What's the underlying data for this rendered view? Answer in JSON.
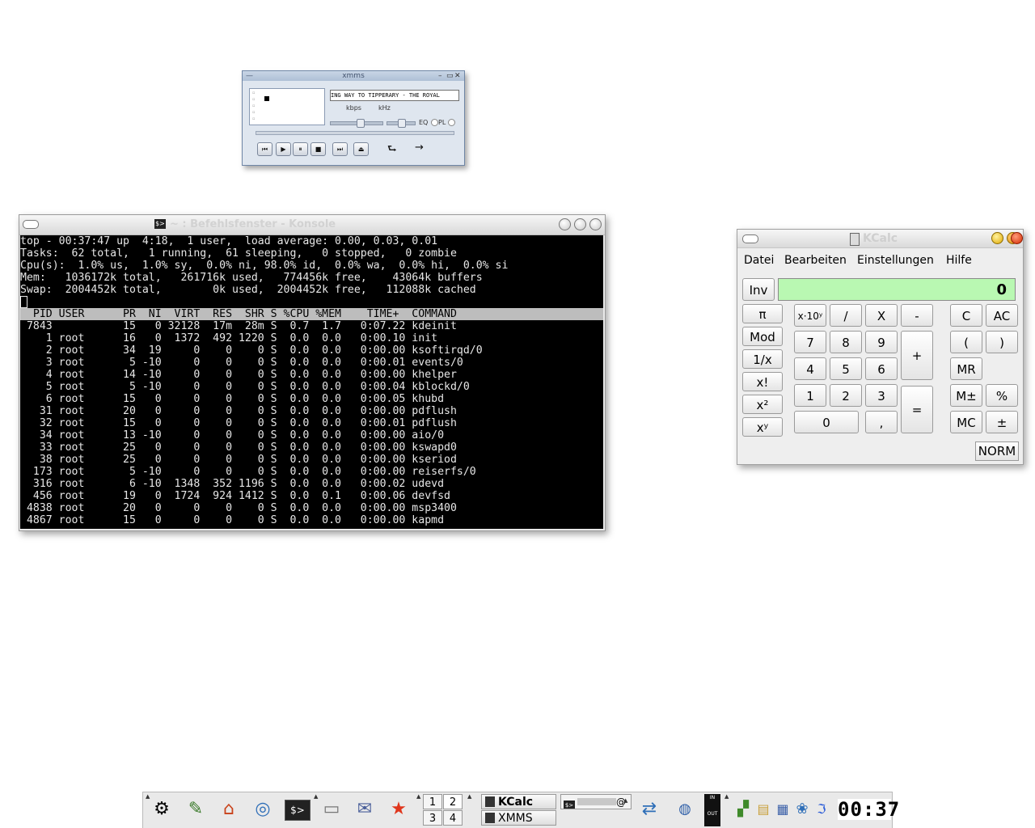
{
  "xmms": {
    "title": "xmms",
    "song": "ING WAY TO TIPPERARY - THE ROYAL",
    "kbps_label": "kbps",
    "khz_label": "kHz",
    "eq_label": "EQ",
    "pl_label": "PL",
    "buttons": [
      "⏮",
      "▶",
      "⏸",
      "■",
      "⏭",
      "⏏"
    ],
    "shuffle_icon": "⮑",
    "repeat_icon": "→"
  },
  "konsole": {
    "title": "~ : Befehlsfenster - Konsole",
    "summary": [
      "top - 00:37:47 up  4:18,  1 user,  load average: 0.00, 0.03, 0.01",
      "Tasks:  62 total,   1 running,  61 sleeping,   0 stopped,   0 zombie",
      "Cpu(s):  1.0% us,  1.0% sy,  0.0% ni, 98.0% id,  0.0% wa,  0.0% hi,  0.0% si",
      "Mem:   1036172k total,   261716k used,   774456k free,    43064k buffers",
      "Swap:  2004452k total,        0k used,  2004452k free,   112088k cached"
    ],
    "header": "  PID USER      PR  NI  VIRT  RES  SHR S %CPU %MEM    TIME+  COMMAND",
    "rows": [
      " 7843           15   0 32128  17m  28m S  0.7  1.7   0:07.22 kdeinit",
      "    1 root      16   0  1372  492 1220 S  0.0  0.0   0:00.10 init",
      "    2 root      34  19     0    0    0 S  0.0  0.0   0:00.00 ksoftirqd/0",
      "    3 root       5 -10     0    0    0 S  0.0  0.0   0:00.01 events/0",
      "    4 root      14 -10     0    0    0 S  0.0  0.0   0:00.00 khelper",
      "    5 root       5 -10     0    0    0 S  0.0  0.0   0:00.04 kblockd/0",
      "    6 root      15   0     0    0    0 S  0.0  0.0   0:00.05 khubd",
      "   31 root      20   0     0    0    0 S  0.0  0.0   0:00.00 pdflush",
      "   32 root      15   0     0    0    0 S  0.0  0.0   0:00.01 pdflush",
      "   34 root      13 -10     0    0    0 S  0.0  0.0   0:00.00 aio/0",
      "   33 root      25   0     0    0    0 S  0.0  0.0   0:00.00 kswapd0",
      "   38 root      25   0     0    0    0 S  0.0  0.0   0:00.00 kseriod",
      "  173 root       5 -10     0    0    0 S  0.0  0.0   0:00.00 reiserfs/0",
      "  316 root       6 -10  1348  352 1196 S  0.0  0.0   0:00.02 udevd",
      "  456 root      19   0  1724  924 1412 S  0.0  0.1   0:00.06 devfsd",
      " 4838 root      20   0     0    0    0 S  0.0  0.0   0:00.00 msp3400",
      " 4867 root      15   0     0    0    0 S  0.0  0.0   0:00.00 kapmd"
    ]
  },
  "kcalc": {
    "title": "KCalc",
    "menu": [
      "Datei",
      "Bearbeiten",
      "Einstellungen",
      "Hilfe"
    ],
    "display": "0",
    "inv": "Inv",
    "pi": "π",
    "x10y": "x·10ʸ",
    "div": "/",
    "mul": "X",
    "minus": "-",
    "clear": "C",
    "all_clear": "AC",
    "mod": "Mod",
    "seven": "7",
    "eight": "8",
    "nine": "9",
    "plus": "+",
    "lparen": "(",
    "rparen": ")",
    "recip": "1/x",
    "four": "4",
    "five": "5",
    "six": "6",
    "mr": "MR",
    "fact": "x!",
    "one": "1",
    "two": "2",
    "three": "3",
    "equals": "=",
    "mpm": "M±",
    "percent": "%",
    "sq": "x²",
    "zero": "0",
    "comma": ",",
    "mc": "MC",
    "plusminus": "±",
    "pow": "xʸ",
    "norm": "NORM"
  },
  "taskbar": {
    "pager": [
      "1",
      "2",
      "3",
      "4"
    ],
    "tasks": [
      "KCalc",
      "XMMS"
    ],
    "konsole_task": "@",
    "clock": "00:37"
  },
  "colors": {
    "calc_display": "#b9f8b2",
    "terminal_bg": "#000000",
    "terminal_fg": "#e7e7e7"
  }
}
